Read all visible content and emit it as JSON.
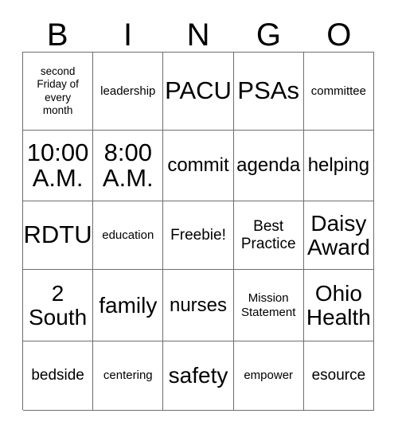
{
  "card": {
    "title_letters": [
      "B",
      "I",
      "N",
      "G",
      "O"
    ],
    "columns": 5,
    "rows": 5,
    "border_color": "#6e6e6e",
    "text_color": "#000000",
    "background_color": "#ffffff",
    "cells": [
      {
        "text": "second\nFriday of\nevery\nmonth",
        "size": "fs-xs"
      },
      {
        "text": "leadership",
        "size": "fs-sm"
      },
      {
        "text": "PACU",
        "size": "fs-xxl"
      },
      {
        "text": "PSAs",
        "size": "fs-xxl"
      },
      {
        "text": "committee",
        "size": "fs-sm"
      },
      {
        "text": "10:00\nA.M.",
        "size": "fs-xxl"
      },
      {
        "text": "8:00\nA.M.",
        "size": "fs-xxl"
      },
      {
        "text": "commit",
        "size": "fs-lg"
      },
      {
        "text": "agenda",
        "size": "fs-lg"
      },
      {
        "text": "helping",
        "size": "fs-lg"
      },
      {
        "text": "RDTU",
        "size": "fs-xxl"
      },
      {
        "text": "education",
        "size": "fs-sm"
      },
      {
        "text": "Freebie!",
        "size": "fs-md"
      },
      {
        "text": "Best\nPractice",
        "size": "fs-md"
      },
      {
        "text": "Daisy\nAward",
        "size": "fs-xl"
      },
      {
        "text": "2\nSouth",
        "size": "fs-xl"
      },
      {
        "text": "family",
        "size": "fs-xl"
      },
      {
        "text": "nurses",
        "size": "fs-lg"
      },
      {
        "text": "Mission\nStatement",
        "size": "fs-sm"
      },
      {
        "text": "Ohio\nHealth",
        "size": "fs-xl"
      },
      {
        "text": "bedside",
        "size": "fs-md"
      },
      {
        "text": "centering",
        "size": "fs-sm"
      },
      {
        "text": "safety",
        "size": "fs-xl"
      },
      {
        "text": "empower",
        "size": "fs-sm"
      },
      {
        "text": "esource",
        "size": "fs-md"
      }
    ]
  }
}
